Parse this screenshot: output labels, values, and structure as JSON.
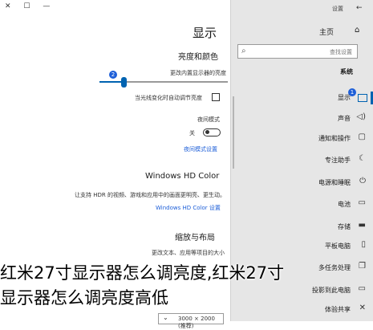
{
  "window": {
    "title": "设置",
    "controls": [
      "✕",
      "☐",
      "—"
    ]
  },
  "nav": {
    "back_icon": "arrow-left-icon",
    "home_label": "主页",
    "search_placeholder": "查找设置",
    "group_label": "系统",
    "items": [
      {
        "label": "显示",
        "icon": "monitor-icon",
        "active": true
      },
      {
        "label": "声音",
        "icon": "speaker-icon"
      },
      {
        "label": "通知和操作",
        "icon": "notification-icon"
      },
      {
        "label": "专注助手",
        "icon": "moon-icon"
      },
      {
        "label": "电源和睡眠",
        "icon": "power-icon"
      },
      {
        "label": "电池",
        "icon": "battery-icon"
      },
      {
        "label": "存储",
        "icon": "storage-icon"
      },
      {
        "label": "平板电脑",
        "icon": "tablet-icon"
      },
      {
        "label": "多任务处理",
        "icon": "multitask-icon"
      },
      {
        "label": "投影到此电脑",
        "icon": "project-icon"
      },
      {
        "label": "体验共享",
        "icon": "share-icon"
      }
    ],
    "badge": "1"
  },
  "content": {
    "title": "显示",
    "brightness": {
      "heading": "亮度和颜色",
      "slider_label": "更改内置显示器的亮度",
      "badge": "2",
      "level_fraction": 0.19,
      "auto_checkbox_label": "当光线变化时自动调节亮度",
      "auto_checked": false
    },
    "night_light": {
      "label": "夜间模式",
      "state": "关",
      "settings_link": "夜间模式设置"
    },
    "hd_color": {
      "heading": "Windows HD Color",
      "description_1": "让支持 HDR 的视频、游戏和应用中的画面更明亮、更生动。",
      "link": "Windows HD Color 设置"
    },
    "scale": {
      "heading": "缩放与布局",
      "label": "更改文本、应用等项目的大小",
      "dropdown_value": "3000 × 2000 (推荐)"
    }
  },
  "caption": {
    "line1": "红米27寸显示器怎么调亮度,红米27寸",
    "line2": "显示器怎么调亮度高低"
  },
  "colors": {
    "accent": "#0063b1",
    "pane_bg": "#e6e6e6",
    "link": "#1e5fd8"
  }
}
